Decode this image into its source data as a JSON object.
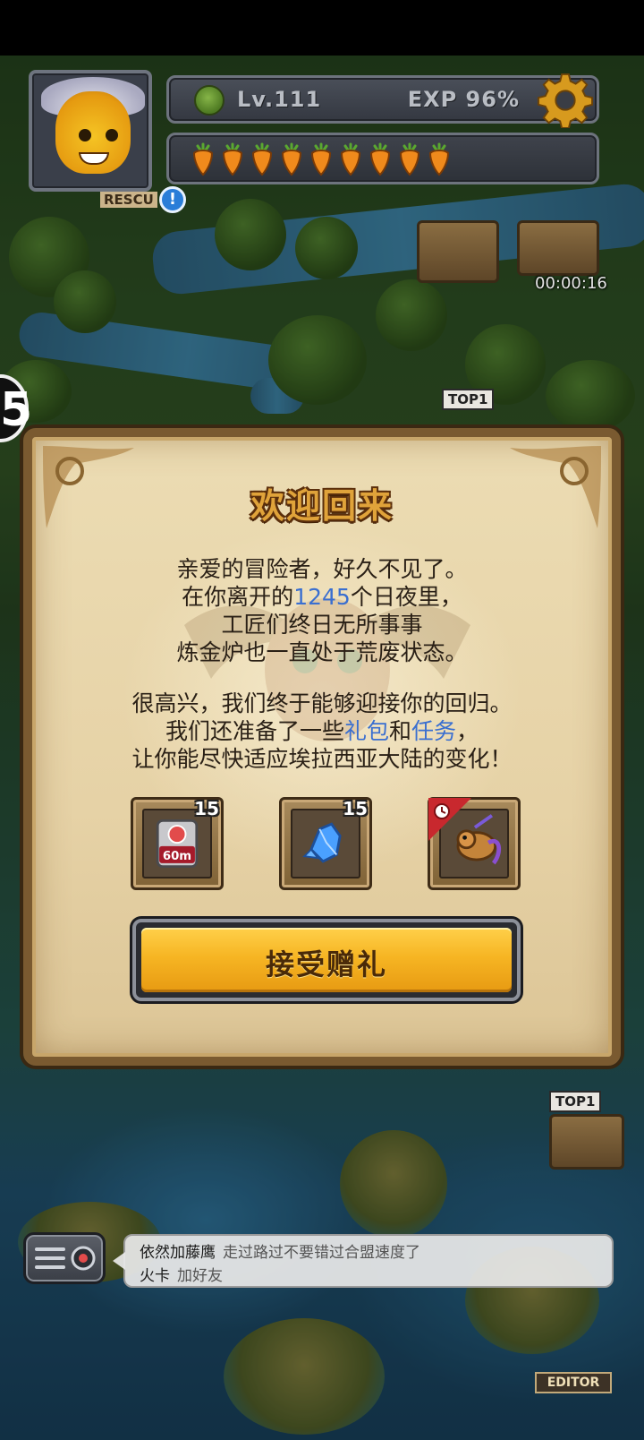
{
  "hud": {
    "level": "Lv.111",
    "exp": "EXP 96%",
    "carrot_count": 9,
    "rescue_label": "RESCU",
    "timer": "00:00:16",
    "side_badge": "5",
    "top_tag_1": "TOP1",
    "top_tag_2": "TOP1",
    "editor_label": "EDITOR"
  },
  "dialog": {
    "title": "欢迎回来",
    "para1": [
      {
        "text": "亲爱的冒险者，好久不见了。"
      },
      {
        "pre": "在你离开的",
        "hl": "1245",
        "post": "个日夜里，"
      },
      {
        "text": "工匠们终日无所事事"
      },
      {
        "text": "炼金炉也一直处于荒废状态。"
      }
    ],
    "para2": [
      {
        "text": "很高兴，我们终于能够迎接你的回归。"
      },
      {
        "pre": "我们还准备了一些",
        "hl": "礼包",
        "mid": "和",
        "hl2": "任务",
        "post": "，"
      },
      {
        "text": "让你能尽快适应埃拉西亚大陆的变化！"
      }
    ],
    "items": [
      {
        "icon": "speedup-60m-icon",
        "label": "60m",
        "count": "15"
      },
      {
        "icon": "blue-crystal-icon",
        "count": "15"
      },
      {
        "icon": "dragon-pet-icon",
        "count": ""
      }
    ],
    "accept_label": "接受赠礼"
  },
  "chat": {
    "line1_name": "依然加藤鹰",
    "line1_msg": "走过路过不要错过合盟速度了",
    "line2_name": "火卡",
    "line2_msg": "加好友"
  },
  "colors": {
    "title": "#e0a33a",
    "highlight": "#3a6fd0",
    "button": "#f6b523"
  }
}
